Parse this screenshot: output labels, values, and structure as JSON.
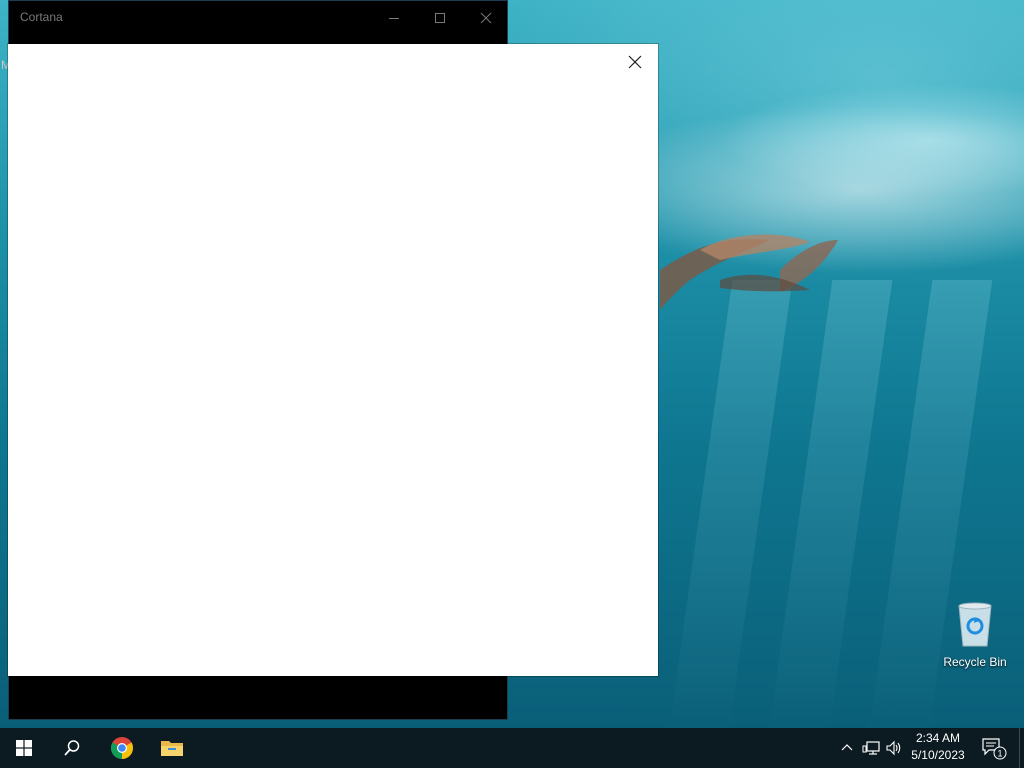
{
  "cortana_window": {
    "title": "Cortana",
    "left_edge_label": "M",
    "titlebar_buttons": [
      "minimize-icon",
      "maximize-icon",
      "close-icon"
    ]
  },
  "dialog": {
    "close_icon": "close-icon"
  },
  "desktop": {
    "icons": [
      {
        "label": "Recycle Bin",
        "icon": "recycle-bin-icon"
      }
    ]
  },
  "taskbar": {
    "pinned": [
      {
        "name": "Start",
        "icon": "windows-logo-icon"
      },
      {
        "name": "Search",
        "icon": "search-icon"
      },
      {
        "name": "Google Chrome",
        "icon": "chrome-icon"
      },
      {
        "name": "File Explorer",
        "icon": "folder-icon"
      }
    ],
    "tray": {
      "icons": [
        "chevron-up-icon",
        "network-icon",
        "volume-icon"
      ],
      "time": "2:34 AM",
      "date": "5/10/2023",
      "notification_count": "1"
    }
  },
  "colors": {
    "taskbar": "#0c1a21",
    "water_light": "#3fb3c6",
    "water_dark": "#0a5f78",
    "window": "#000000",
    "dialog": "#ffffff"
  }
}
